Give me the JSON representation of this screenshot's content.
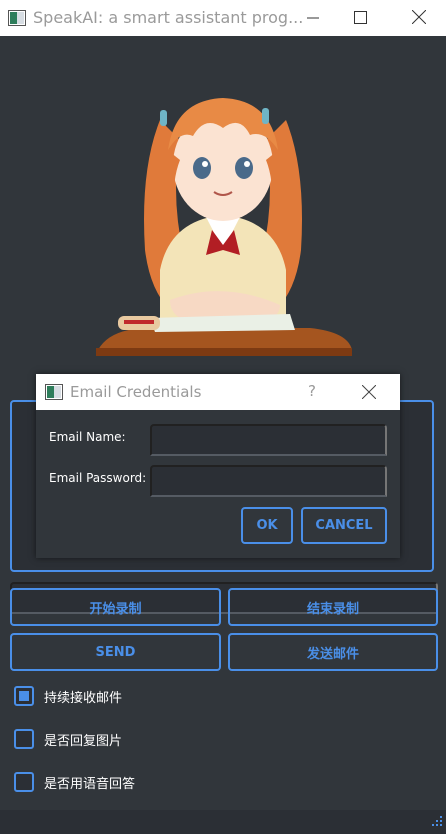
{
  "window": {
    "title": "SpeakAI: a smart assistant prog...",
    "app_icon": "window-app-icon",
    "minimize_icon": "minimize-icon",
    "maximize_icon": "maximize-icon",
    "close_icon": "close-icon"
  },
  "main": {
    "avatar": "anime-girl-avatar",
    "buttons": {
      "start_record": "开始录制",
      "stop_record": "结束录制",
      "send": "SEND",
      "send_email": "发送邮件"
    },
    "checkboxes": [
      {
        "label": "持续接收邮件",
        "checked": true
      },
      {
        "label": "是否回复图片",
        "checked": false
      },
      {
        "label": "是否用语音回答",
        "checked": false
      }
    ]
  },
  "dialog": {
    "title": "Email Credentials",
    "help_icon": "?",
    "email_name_label": "Email Name:",
    "email_name_value": "",
    "email_password_label": "Email Password:",
    "email_password_value": "",
    "ok_label": "OK",
    "cancel_label": "CANCEL"
  },
  "colors": {
    "accent": "#4a8fe8",
    "background": "#31363b",
    "input_bg": "#2b2f35"
  }
}
